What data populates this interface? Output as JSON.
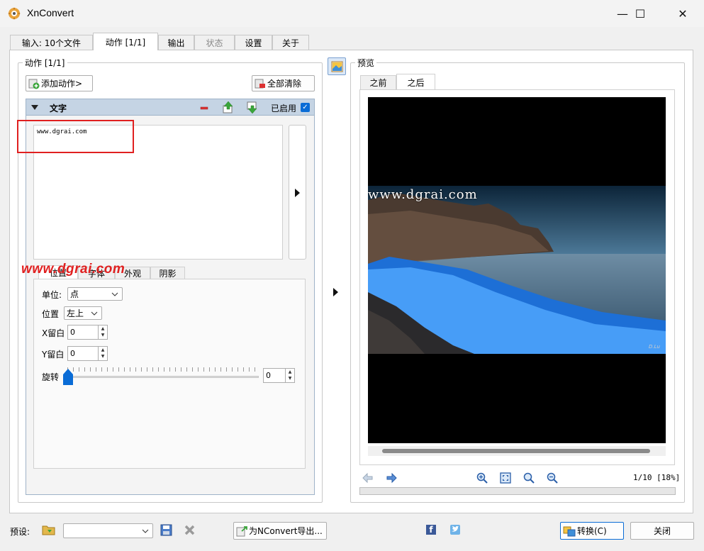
{
  "window": {
    "title": "XnConvert",
    "controls": {
      "minimize": "—",
      "maximize": "☐",
      "close": "✕"
    }
  },
  "main_tabs": [
    {
      "label": "输入: 10个文件",
      "active": false,
      "disabled": false
    },
    {
      "label": "动作 [1/1]",
      "active": true,
      "disabled": false
    },
    {
      "label": "输出",
      "active": false,
      "disabled": false
    },
    {
      "label": "状态",
      "active": false,
      "disabled": true
    },
    {
      "label": "设置",
      "active": false,
      "disabled": false
    },
    {
      "label": "关于",
      "active": false,
      "disabled": false
    }
  ],
  "actions_group": {
    "title": "动作 [1/1]",
    "add_action_label": "添加动作>",
    "clear_all_label": "全部清除"
  },
  "action_item": {
    "name": "文字",
    "enabled_label": "已启用",
    "enabled": true,
    "text_value": "www.dgrai.com"
  },
  "watermark_overlay": "www.dgrai.com",
  "sub_tabs": [
    {
      "label": "位置"
    },
    {
      "label": "字体"
    },
    {
      "label": "外观"
    },
    {
      "label": "阴影"
    }
  ],
  "fields": {
    "unit_label": "单位:",
    "unit_value": "点",
    "position_label": "位置",
    "position_value": "左上",
    "x_margin_label": "X留白",
    "x_margin_value": "0",
    "y_margin_label": "Y留白",
    "y_margin_value": "0",
    "rotation_label": "旋转",
    "rotation_value": "0"
  },
  "preview": {
    "title": "预览",
    "tab_before": "之前",
    "tab_after": "之后",
    "overlay_text": "www.dgrai.com",
    "status": "1/10 [18%]",
    "signature": "D.Lu"
  },
  "bottom": {
    "preset_label": "预设:",
    "preset_value": "",
    "export_label": "为NConvert导出...",
    "convert_label": "转换(C)",
    "close_label": "关闭"
  },
  "colors": {
    "accent": "#0a6cd6",
    "header_blue": "#c5d4e4",
    "highlight_red": "#e02020"
  }
}
